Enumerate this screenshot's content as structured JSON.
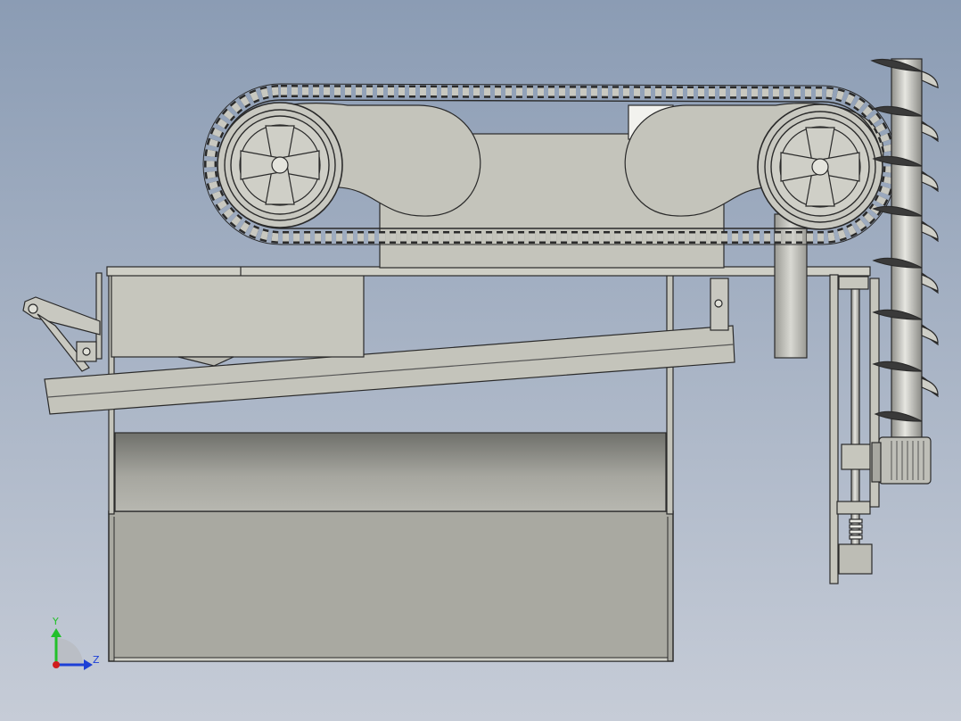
{
  "viewport": {
    "background_top": "#8b9cb4",
    "background_bottom": "#c6ccd7"
  },
  "triad": {
    "y_label": "Y",
    "z_label": "Z",
    "y_color": "#22c02a",
    "z_color": "#1d3fd6",
    "x_color": "#d01c1c"
  },
  "model": {
    "part_color": "#c4c4bb",
    "part_stroke": "#2a2a2a"
  }
}
